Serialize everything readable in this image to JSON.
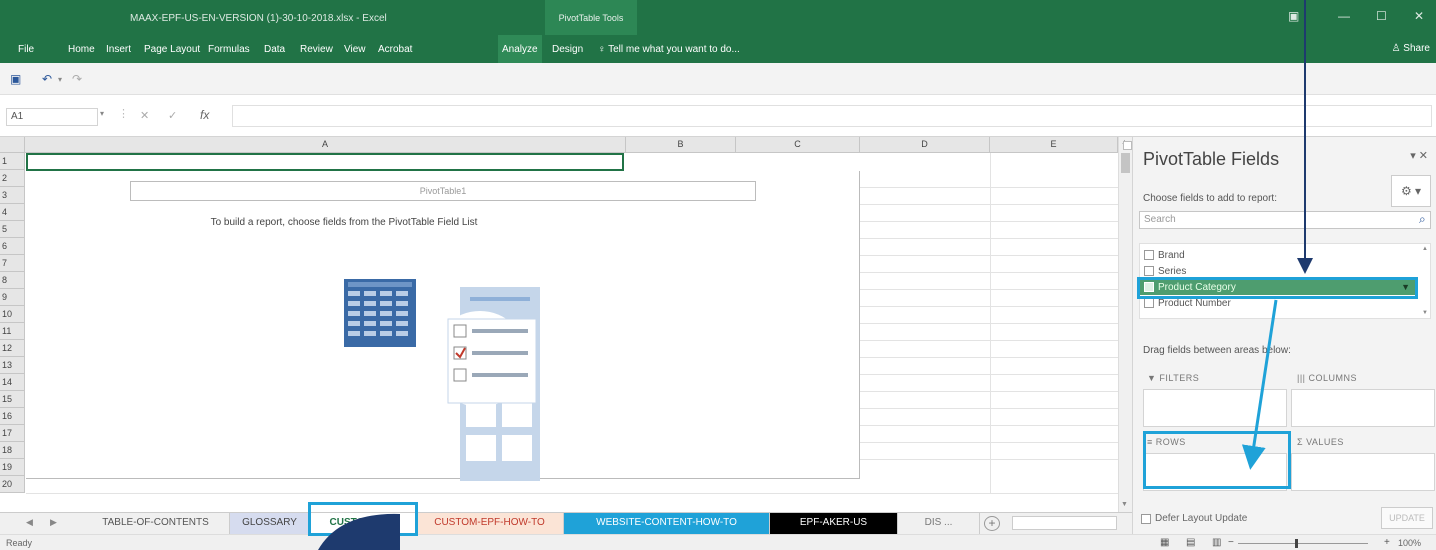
{
  "window": {
    "title": "MAAX-EPF-US-EN-VERSION (1)-30-10-2018.xlsx - Excel",
    "context_tab": "PivotTable Tools",
    "minimize": "—",
    "restore": "☐",
    "close": "✕"
  },
  "ribbon": {
    "tabs": [
      "File",
      "Home",
      "Insert",
      "Page Layout",
      "Formulas",
      "Data",
      "Review",
      "View",
      "Acrobat",
      "Analyze",
      "Design"
    ],
    "tell_me": "♀ Tell me what you want to do...",
    "share": "♙ Share"
  },
  "formula_bar": {
    "name_box": "A1",
    "fx": "fx",
    "cancel": "✕",
    "enter": "✓"
  },
  "grid": {
    "columns": [
      "A",
      "B",
      "C",
      "D",
      "E"
    ],
    "rows": [
      "1",
      "2",
      "3",
      "4",
      "5",
      "6",
      "7",
      "8",
      "9",
      "10",
      "11",
      "12",
      "13",
      "14",
      "15",
      "16",
      "17",
      "18",
      "19",
      "20"
    ],
    "pivot_name": "PivotTable1",
    "pivot_message": "To build a report, choose fields from the PivotTable Field List"
  },
  "sheet_tabs": [
    {
      "label": "TABLE-OF-CONTENTS",
      "color": "#f0f0f0",
      "text": "#555"
    },
    {
      "label": "GLOSSARY",
      "color": "#d6dcef",
      "text": "#444"
    },
    {
      "label": "CUSTOM-EPF",
      "color": "#ffffff",
      "text": "#217346"
    },
    {
      "label": "CUSTOM-EPF-HOW-TO",
      "color": "#fbe4d6",
      "text": "#c0392b"
    },
    {
      "label": "WEBSITE-CONTENT-HOW-TO",
      "color": "#1fa2d8",
      "text": "#ffffff"
    },
    {
      "label": "EPF-AKER-US",
      "color": "#000000",
      "text": "#ffffff"
    },
    {
      "label": "DIS ...",
      "color": "#f0f0f0",
      "text": "#777"
    }
  ],
  "status_bar": {
    "status": "Ready",
    "zoom": "100%"
  },
  "pivot_pane": {
    "title": "PivotTable Fields",
    "close_controls": "▾ ✕",
    "subtitle": "Choose fields to add to report:",
    "gear": "⚙ ▾",
    "search_placeholder": "Search",
    "fields": [
      "Brand",
      "Series",
      "Product Category",
      "Product Number"
    ],
    "selected_field": "Product Category",
    "drag_hint": "Drag fields between areas below:",
    "areas": {
      "filters": "▼ FILTERS",
      "columns": "||| COLUMNS",
      "rows": "≡ ROWS",
      "values": "Σ VALUES"
    },
    "defer": "Defer Layout Update",
    "update": "UPDATE"
  },
  "annotation_color": "#1fa2d8"
}
